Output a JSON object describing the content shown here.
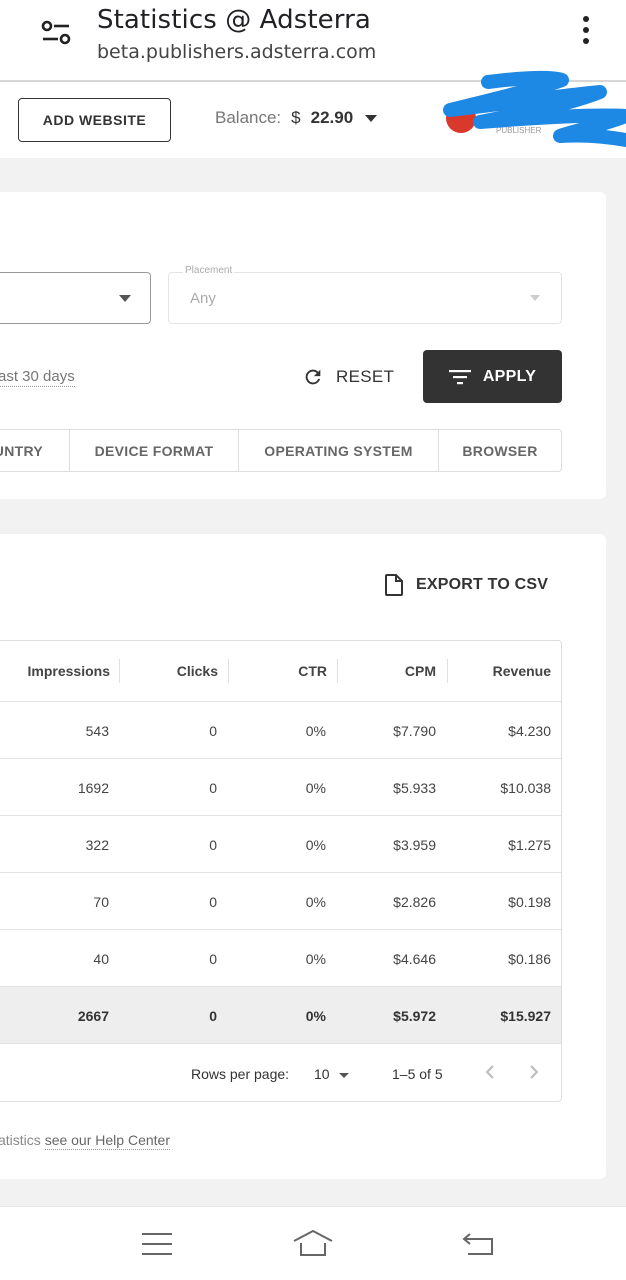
{
  "browser": {
    "title": "Statistics @ Adsterra",
    "url": "beta.publishers.adsterra.com"
  },
  "header": {
    "add_website": "ADD WEBSITE",
    "balance_label": "Balance:",
    "balance_currency": "$",
    "balance_value": "22.90",
    "account_caption": "PUBLISHER",
    "avatar_color": "#d8392b"
  },
  "filters": {
    "placement_label": "Placement",
    "placement_value": "Any",
    "date_range": "ast 30 days",
    "reset": "RESET",
    "apply": "APPLY",
    "tabs": [
      "UNTRY",
      "DEVICE FORMAT",
      "OPERATING SYSTEM",
      "BROWSER"
    ]
  },
  "stats": {
    "export": "EXPORT TO CSV",
    "columns": [
      "Impressions",
      "Clicks",
      "CTR",
      "CPM",
      "Revenue"
    ],
    "rows": [
      [
        "543",
        "0",
        "0%",
        "$7.790",
        "$4.230"
      ],
      [
        "1692",
        "0",
        "0%",
        "$5.933",
        "$10.038"
      ],
      [
        "322",
        "0",
        "0%",
        "$3.959",
        "$1.275"
      ],
      [
        "70",
        "0",
        "0%",
        "$2.826",
        "$0.198"
      ],
      [
        "40",
        "0",
        "0%",
        "$4.646",
        "$0.186"
      ]
    ],
    "totals": [
      "2667",
      "0",
      "0%",
      "$5.972",
      "$15.927"
    ],
    "rows_per_page_label": "Rows per page:",
    "rows_per_page_value": "10",
    "range": "1–5 of 5",
    "help_text": "atistics ",
    "help_link": "see our Help Center"
  },
  "colors": {
    "primary_dark": "#333333",
    "scribble": "#1e88e5"
  }
}
